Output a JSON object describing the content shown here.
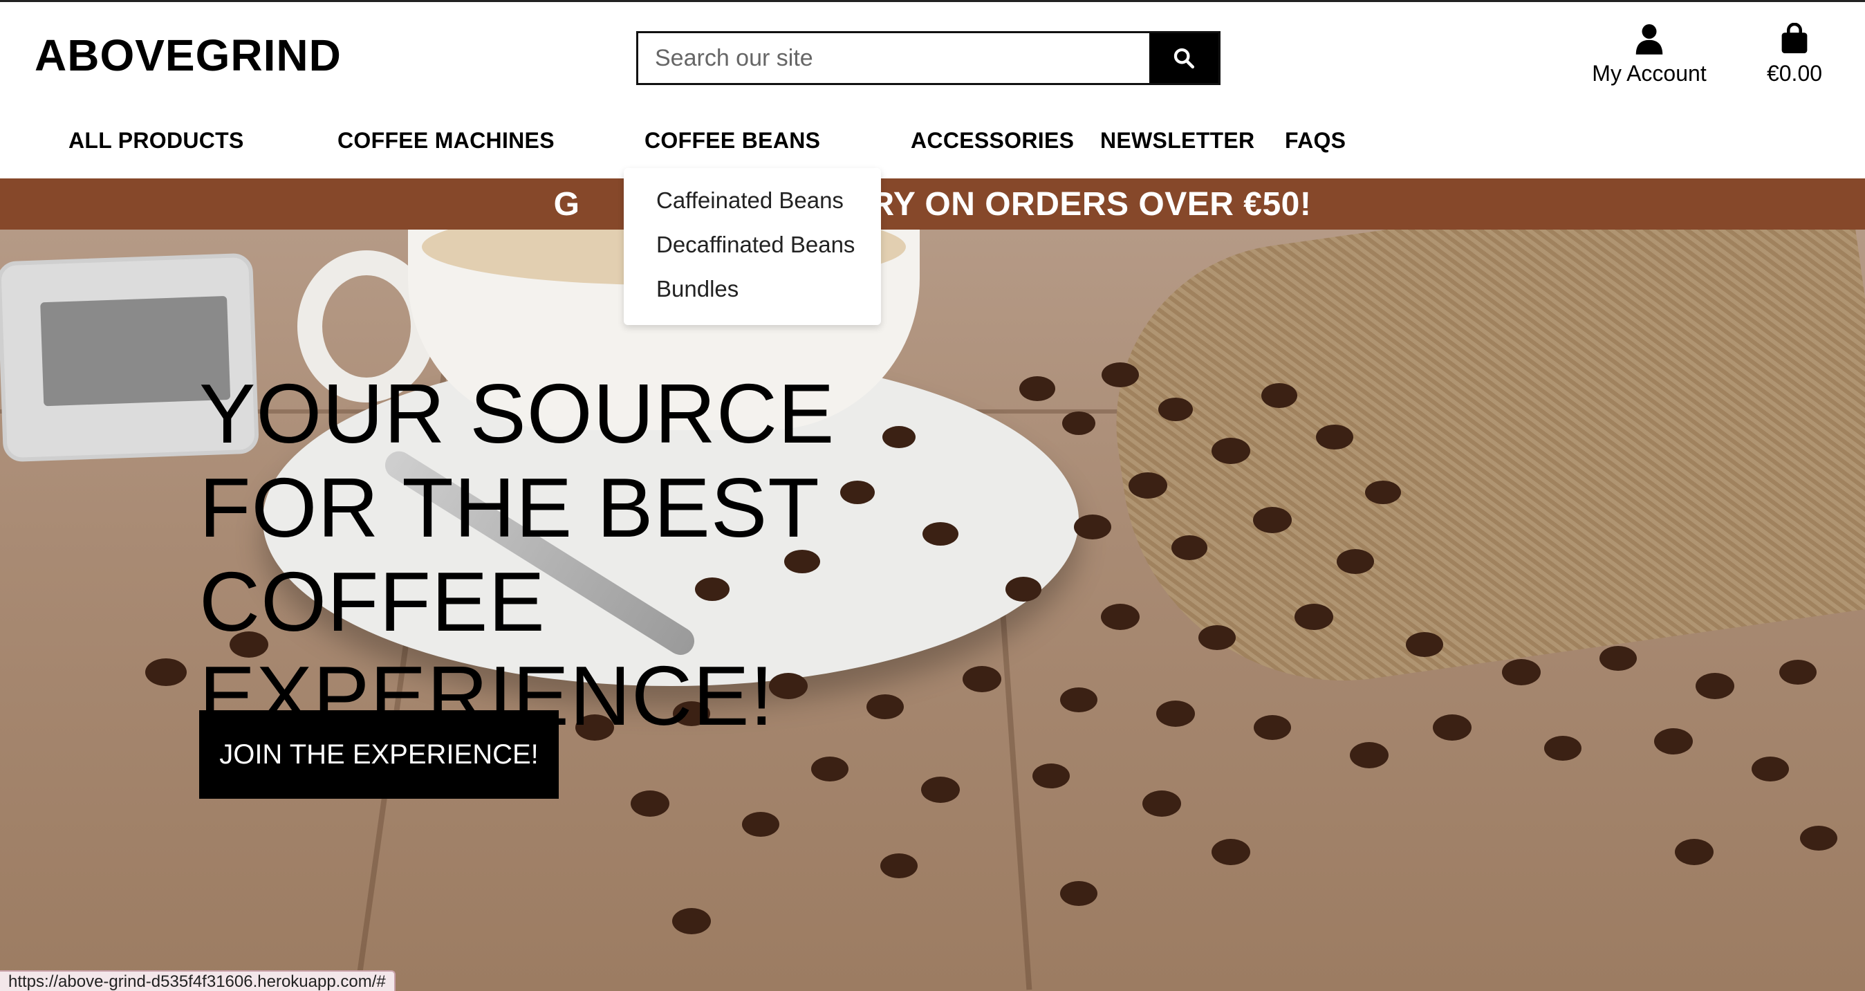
{
  "header": {
    "logo": "ABOVEGRIND",
    "search_placeholder": "Search our site",
    "search_icon": "search-icon",
    "account_label": "My Account",
    "account_icon": "user-icon",
    "bag_total": "€0.00",
    "bag_icon": "shopping-bag-icon"
  },
  "nav": [
    {
      "label": "ALL PRODUCTS"
    },
    {
      "label": "COFFEE MACHINES"
    },
    {
      "label": "COFFEE BEANS"
    },
    {
      "label": "ACCESSORIES"
    },
    {
      "label": "NEWSLETTER"
    },
    {
      "label": "FAQS"
    }
  ],
  "dropdown": {
    "items": [
      "Caffeinated Beans",
      "Decaffinated Beans",
      "Bundles"
    ]
  },
  "banner": {
    "visible_left": "G",
    "visible_right": "RY ON ORDERS OVER €50!"
  },
  "hero": {
    "title": "YOUR SOURCE FOR THE BEST COFFEE EXPERIENCE!",
    "cta_label": "JOIN THE EXPERIENCE!"
  },
  "status_url": "https://above-grind-d535f4f31606.herokuapp.com/#",
  "colors": {
    "banner_bg": "#86482a",
    "button_bg": "#000000"
  }
}
